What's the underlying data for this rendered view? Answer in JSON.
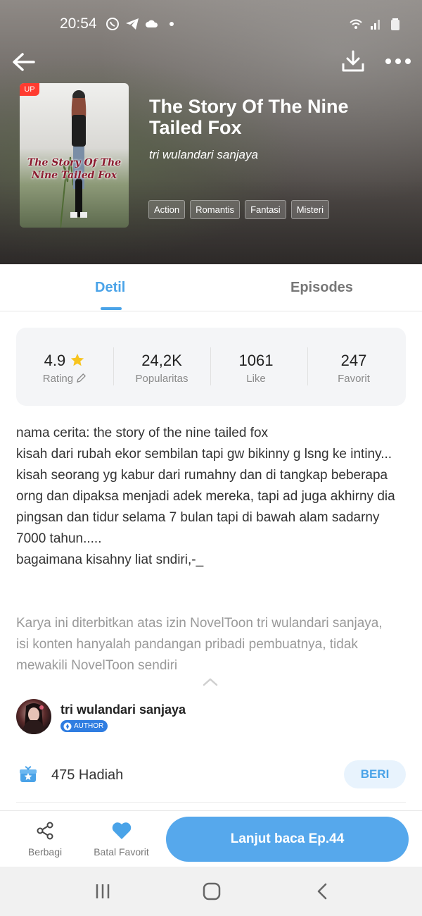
{
  "status_bar": {
    "time": "20:54"
  },
  "book": {
    "title": "The Story Of The Nine Tailed Fox",
    "cover_badge": "UP",
    "cover_title": "The Story Of The Nine Tailed Fox",
    "author": "tri wulandari sanjaya",
    "tags": [
      "Action",
      "Romantis",
      "Fantasi",
      "Misteri"
    ]
  },
  "tabs": {
    "detail": "Detil",
    "episodes": "Episodes",
    "active": "detail"
  },
  "stats": {
    "rating": {
      "value": "4.9",
      "label": "Rating"
    },
    "popularity": {
      "value": "24,2K",
      "label": "Popularitas"
    },
    "likes": {
      "value": "1061",
      "label": "Like"
    },
    "favorites": {
      "value": "247",
      "label": "Favorit"
    }
  },
  "description": {
    "lines": [
      "nama cerita: the story of the nine tailed fox",
      "kisah dari rubah ekor sembilan tapi gw bikinny g lsng ke intiny...",
      "kisah seorang yg kabur dari rumahny dan di tangkap beberapa orng dan dipaksa menjadi adek mereka, tapi ad juga akhirny dia pingsan dan tidur selama 7 bulan tapi di bawah alam sadarny 7000 tahun.....",
      "bagaimana kisahny liat sndiri,-_"
    ],
    "disclaimer": "Karya ini diterbitkan atas izin NovelToon tri wulandari sanjaya, isi konten hanyalah pandangan pribadi pembuatnya, tidak mewakili NovelToon sendiri"
  },
  "author_card": {
    "name": "tri wulandari sanjaya",
    "badge": "AUTHOR"
  },
  "gifts": {
    "count_text": "475 Hadiah",
    "button": "BERI"
  },
  "actions": {
    "share_label": "Berbagi",
    "favorite_label": "Batal Favorit",
    "continue_label": "Lanjut baca Ep.44"
  },
  "colors": {
    "accent": "#4aa3e8",
    "button": "#56a8ec",
    "star": "#f7c41f",
    "badge": "#2f7de1",
    "up_badge": "#ff3b30"
  }
}
